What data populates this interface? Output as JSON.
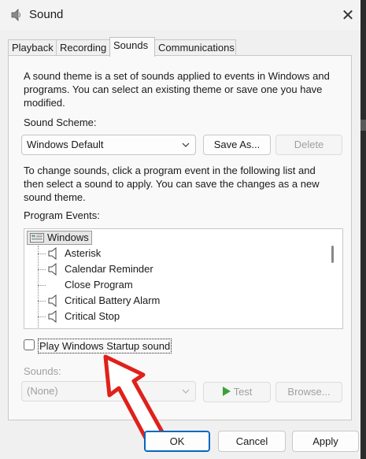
{
  "window": {
    "title": "Sound",
    "icon": "speaker-icon",
    "close_glyph": "✕"
  },
  "tabs": [
    {
      "label": "Playback",
      "active": false
    },
    {
      "label": "Recording",
      "active": false
    },
    {
      "label": "Sounds",
      "active": true
    },
    {
      "label": "Communications",
      "active": false
    }
  ],
  "sounds_tab": {
    "description_lines": [
      "A sound theme is a set of sounds applied to events in Windows and",
      "programs.  You can select an existing theme or save one you have",
      "modified."
    ],
    "scheme_label": "Sound Scheme:",
    "scheme_value": "Windows Default",
    "save_as_label": "Save As...",
    "delete_label": "Delete",
    "instructions_lines": [
      "To change sounds, click a program event in the following list and",
      "then select a sound to apply.  You can save the changes as a new",
      "sound theme."
    ],
    "program_events_label": "Program Events:",
    "events_root": "Windows",
    "events": [
      {
        "label": "Asterisk",
        "has_sound": true
      },
      {
        "label": "Calendar Reminder",
        "has_sound": true
      },
      {
        "label": "Close Program",
        "has_sound": false
      },
      {
        "label": "Critical Battery Alarm",
        "has_sound": true
      },
      {
        "label": "Critical Stop",
        "has_sound": true
      }
    ],
    "startup_sound_label": "Play Windows Startup sound",
    "startup_sound_checked": false,
    "sounds_label": "Sounds:",
    "sounds_value": "(None)",
    "test_label": "Test",
    "browse_label": "Browse..."
  },
  "footer": {
    "ok_label": "OK",
    "cancel_label": "Cancel",
    "apply_label": "Apply"
  },
  "colors": {
    "accent": "#0067c0",
    "annotation_arrow": "#e0201b",
    "test_icon": "#3aa13a"
  }
}
